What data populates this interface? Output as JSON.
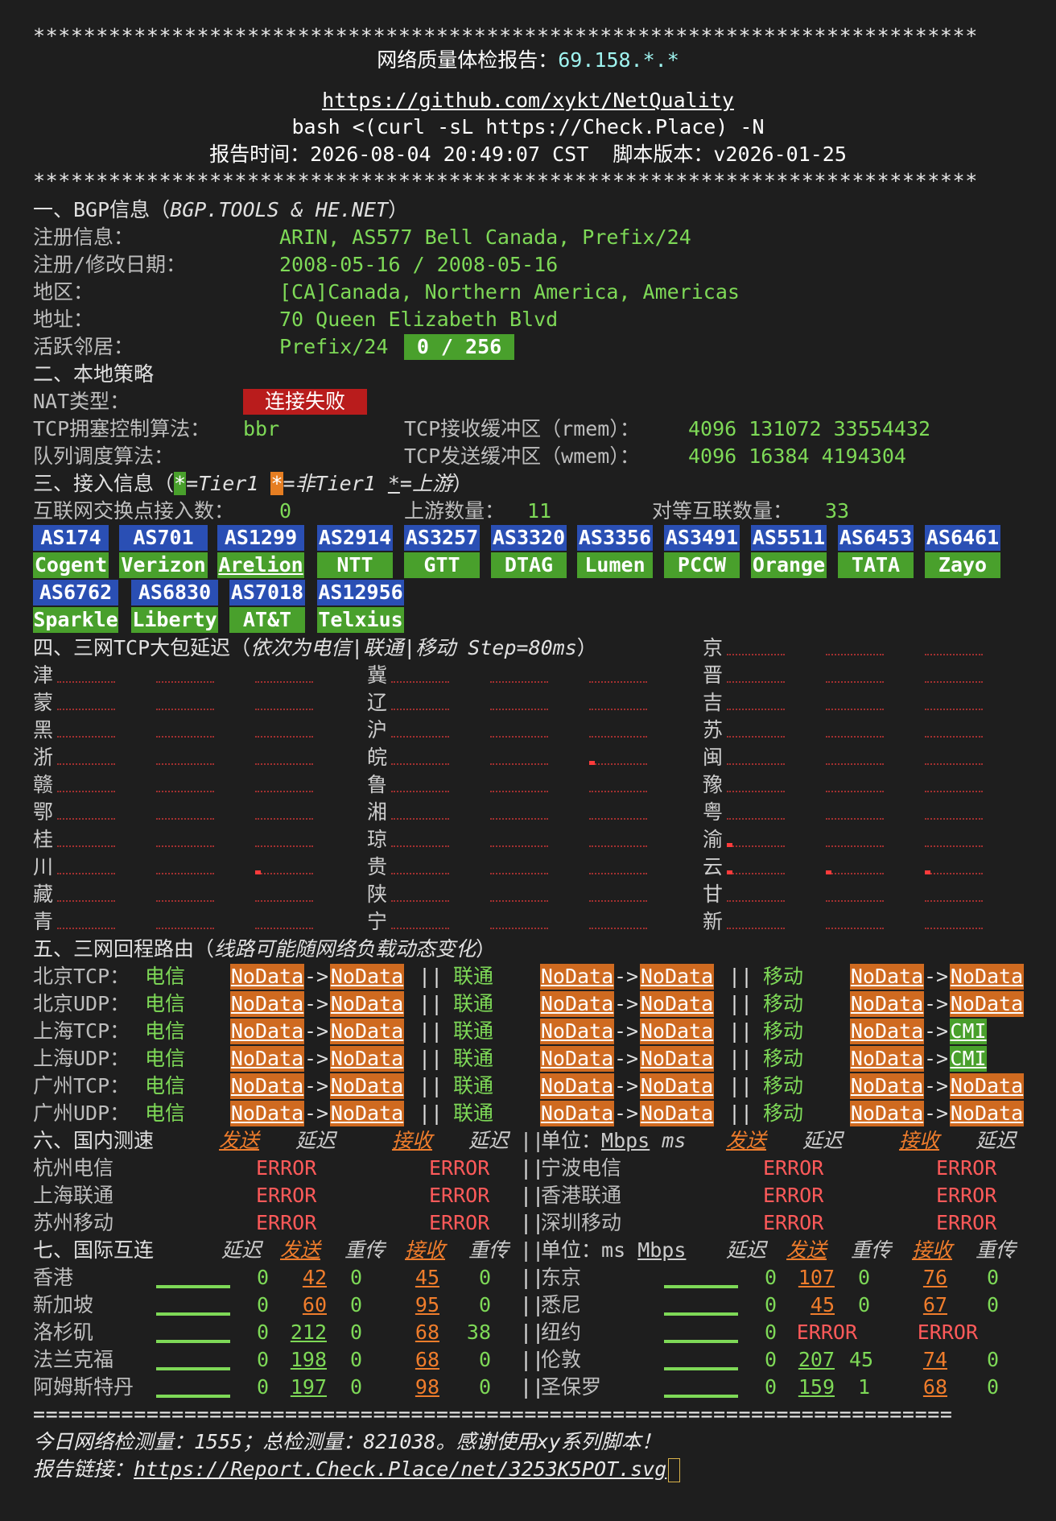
{
  "header": {
    "stars": "***************************************************************************",
    "title_label": "网络质量体检报告：",
    "ip": "69.158.*.*",
    "repo_url": "https://github.com/xykt/NetQuality",
    "command": "bash <(curl -sL https://Check.Place) -N",
    "report_time": "报告时间：2026-08-04 20:49:07 CST  脚本版本：v2026-01-25"
  },
  "bgp": {
    "section_title": "一、BGP信息（",
    "section_src": "BGP.TOOLS & HE.NET",
    "section_close": "）",
    "reg_label": "注册信息：",
    "reg_value": "ARIN, AS577 Bell Canada, Prefix/24",
    "date_label": "注册/修改日期：",
    "date_value": "2008-05-16 / 2008-05-16",
    "region_label": "地区：",
    "region_value": "[CA]Canada, Northern America, Americas",
    "addr_label": "地址：",
    "addr_value": "70 Queen Elizabeth Blvd",
    "neighbor_label": "活跃邻居：",
    "neighbor_prefix": "Prefix/24",
    "neighbor_value": "0 / 256"
  },
  "local": {
    "section_title": "二、本地策略",
    "nat_label": "NAT类型：",
    "nat_value": "连接失败",
    "cc_label": "TCP拥塞控制算法：",
    "cc_value": "bbr",
    "rmem_label": "TCP接收缓冲区（rmem）：",
    "rmem_value": "4096 131072 33554432",
    "queue_label": "队列调度算法：",
    "wmem_label": "TCP发送缓冲区（wmem）：",
    "wmem_value": "4096 16384 4194304"
  },
  "access": {
    "section_title": "三、接入信息（",
    "legend_star": "*",
    "legend_tier1": "=Tier1 ",
    "legend_nontier1": "=非Tier1 ",
    "legend_upstream": "=上游",
    "legend_close": "）",
    "ix_label": "互联网交换点接入数：",
    "ix_value": "0",
    "up_label": "上游数量：",
    "up_value": "11",
    "peer_label": "对等互联数量：",
    "peer_value": "33",
    "asns": [
      {
        "as": "AS174",
        "name": "Cogent"
      },
      {
        "as": "AS701",
        "name": "Verizon"
      },
      {
        "as": "AS1299",
        "name": "Arelion"
      },
      {
        "as": "AS2914",
        "name": "NTT"
      },
      {
        "as": "AS3257",
        "name": "GTT"
      },
      {
        "as": "AS3320",
        "name": "DTAG"
      },
      {
        "as": "AS3356",
        "name": "Lumen"
      },
      {
        "as": "AS3491",
        "name": "PCCW"
      },
      {
        "as": "AS5511",
        "name": "Orange"
      },
      {
        "as": "AS6453",
        "name": "TATA"
      },
      {
        "as": "AS6461",
        "name": "Zayo"
      },
      {
        "as": "AS6762",
        "name": "Sparkle"
      },
      {
        "as": "AS6830",
        "name": "Liberty"
      },
      {
        "as": "AS7018",
        "name": "AT&T"
      },
      {
        "as": "AS12956",
        "name": "Telxius"
      }
    ]
  },
  "latency": {
    "section_title": "四、三网TCP大包延迟（",
    "section_detail": "依次为电信|联通|移动 Step=80ms",
    "section_close": "）",
    "provinces": [
      "京",
      "津",
      "冀",
      "晋",
      "蒙",
      "辽",
      "吉",
      "黑",
      "沪",
      "苏",
      "浙",
      "皖",
      "闽",
      "赣",
      "鲁",
      "豫",
      "鄂",
      "湘",
      "粤",
      "桂",
      "琼",
      "渝",
      "川",
      "贵",
      "云",
      "藏",
      "陕",
      "甘",
      "青",
      "宁",
      "新"
    ]
  },
  "routes": {
    "section_title": "五、三网回程路由（",
    "section_detail": "线路可能随网络负载动态变化",
    "section_close": "）",
    "isp_ct": "电信",
    "isp_cu": "联通",
    "isp_cm": "移动",
    "sep": "||",
    "arrow": "->",
    "rows": [
      {
        "label": "北京TCP：",
        "ct": [
          "NoData",
          "NoData"
        ],
        "cu": [
          "NoData",
          "NoData"
        ],
        "cm": [
          "NoData",
          "NoData"
        ]
      },
      {
        "label": "北京UDP：",
        "ct": [
          "NoData",
          "NoData"
        ],
        "cu": [
          "NoData",
          "NoData"
        ],
        "cm": [
          "NoData",
          "NoData"
        ]
      },
      {
        "label": "上海TCP：",
        "ct": [
          "NoData",
          "NoData"
        ],
        "cu": [
          "NoData",
          "NoData"
        ],
        "cm": [
          "NoData",
          "CMI"
        ]
      },
      {
        "label": "上海UDP：",
        "ct": [
          "NoData",
          "NoData"
        ],
        "cu": [
          "NoData",
          "NoData"
        ],
        "cm": [
          "NoData",
          "CMI"
        ]
      },
      {
        "label": "广州TCP：",
        "ct": [
          "NoData",
          "NoData"
        ],
        "cu": [
          "NoData",
          "NoData"
        ],
        "cm": [
          "NoData",
          "NoData"
        ]
      },
      {
        "label": "广州UDP：",
        "ct": [
          "NoData",
          "NoData"
        ],
        "cu": [
          "NoData",
          "NoData"
        ],
        "cm": [
          "NoData",
          "NoData"
        ]
      }
    ]
  },
  "domestic": {
    "section_title": "六、国内测速",
    "h_send": "发送",
    "h_delay": "延迟",
    "h_recv": "接收",
    "unit_label": "单位：",
    "unit_mbps": "Mbps",
    "unit_ms": "ms",
    "rows": [
      {
        "left": "杭州电信",
        "l_send": "ERROR",
        "l_recv": "ERROR",
        "right": "宁波电信",
        "r_send": "ERROR",
        "r_recv": "ERROR"
      },
      {
        "left": "上海联通",
        "l_send": "ERROR",
        "l_recv": "ERROR",
        "right": "香港联通",
        "r_send": "ERROR",
        "r_recv": "ERROR"
      },
      {
        "left": "苏州移动",
        "l_send": "ERROR",
        "l_recv": "ERROR",
        "right": "深圳移动",
        "r_send": "ERROR",
        "r_recv": "ERROR"
      }
    ]
  },
  "intl": {
    "section_title": "七、国际互连",
    "h_delay": "延迟",
    "h_send": "发送",
    "h_retx": "重传",
    "h_recv": "接收",
    "unit_label": "单位：",
    "unit_ms": "ms",
    "unit_mbps": "Mbps",
    "rows": [
      {
        "left": "香港",
        "l": [
          "0",
          "42",
          "0",
          "45",
          "0"
        ],
        "right": "东京",
        "r": [
          "0",
          "107",
          "0",
          "76",
          "0"
        ]
      },
      {
        "left": "新加坡",
        "l": [
          "0",
          "60",
          "0",
          "95",
          "0"
        ],
        "right": "悉尼",
        "r": [
          "0",
          "45",
          "0",
          "67",
          "0"
        ]
      },
      {
        "left": "洛杉矶",
        "l": [
          "0",
          "212",
          "0",
          "68",
          "38"
        ],
        "right": "纽约",
        "r": [
          "0",
          "ERROR",
          "",
          "ERROR",
          ""
        ]
      },
      {
        "left": "法兰克福",
        "l": [
          "0",
          "198",
          "0",
          "68",
          "0"
        ],
        "right": "伦敦",
        "r": [
          "0",
          "207",
          "45",
          "74",
          "0"
        ]
      },
      {
        "left": "阿姆斯特丹",
        "l": [
          "0",
          "197",
          "0",
          "98",
          "0"
        ],
        "right": "圣保罗",
        "r": [
          "0",
          "159",
          "1",
          "68",
          "0"
        ]
      }
    ]
  },
  "footer": {
    "divider": "=========================================================================",
    "stats": "今日网络检测量：1555；总检测量：821038。感谢使用xy系列脚本！",
    "link_label": "报告链接：",
    "link_url": "https://Report.Check.Place/net/3253K5POT.svg"
  }
}
